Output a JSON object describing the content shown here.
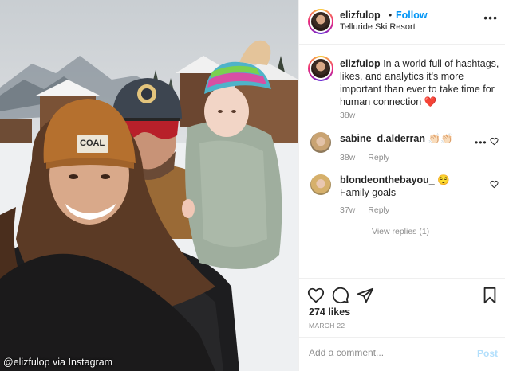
{
  "photo": {
    "beanie_label": "COAL",
    "credit": "@elizfulop via Instagram"
  },
  "header": {
    "username": "elizfulop",
    "dot": "•",
    "follow_label": "Follow",
    "location": "Telluride Ski Resort",
    "more": "•••"
  },
  "caption": {
    "username": "elizfulop",
    "text": "In a world full of hashtags, likes, and analytics it's more important than ever to take time for human connection ❤️",
    "time": "38w"
  },
  "comments": [
    {
      "username": "sabine_d.alderran",
      "text": "👏🏻👏🏻",
      "time": "38w",
      "reply_label": "Reply",
      "more": "•••"
    },
    {
      "username": "blondeonthebayou_",
      "text": "😌 Family goals",
      "time": "37w",
      "reply_label": "Reply"
    }
  ],
  "view_replies": "View replies (1)",
  "actions": {
    "icons": [
      "heart-icon",
      "comment-icon",
      "share-icon",
      "bookmark-icon"
    ],
    "likes": "274 likes",
    "date": "MARCH 22"
  },
  "add_comment": {
    "placeholder": "Add a comment...",
    "post_label": "Post"
  },
  "colors": {
    "link_blue": "#0095f6",
    "post_disabled": "#b2dffc",
    "muted": "#8e8e8e",
    "text": "#262626",
    "heart_red": "#ed4956"
  }
}
